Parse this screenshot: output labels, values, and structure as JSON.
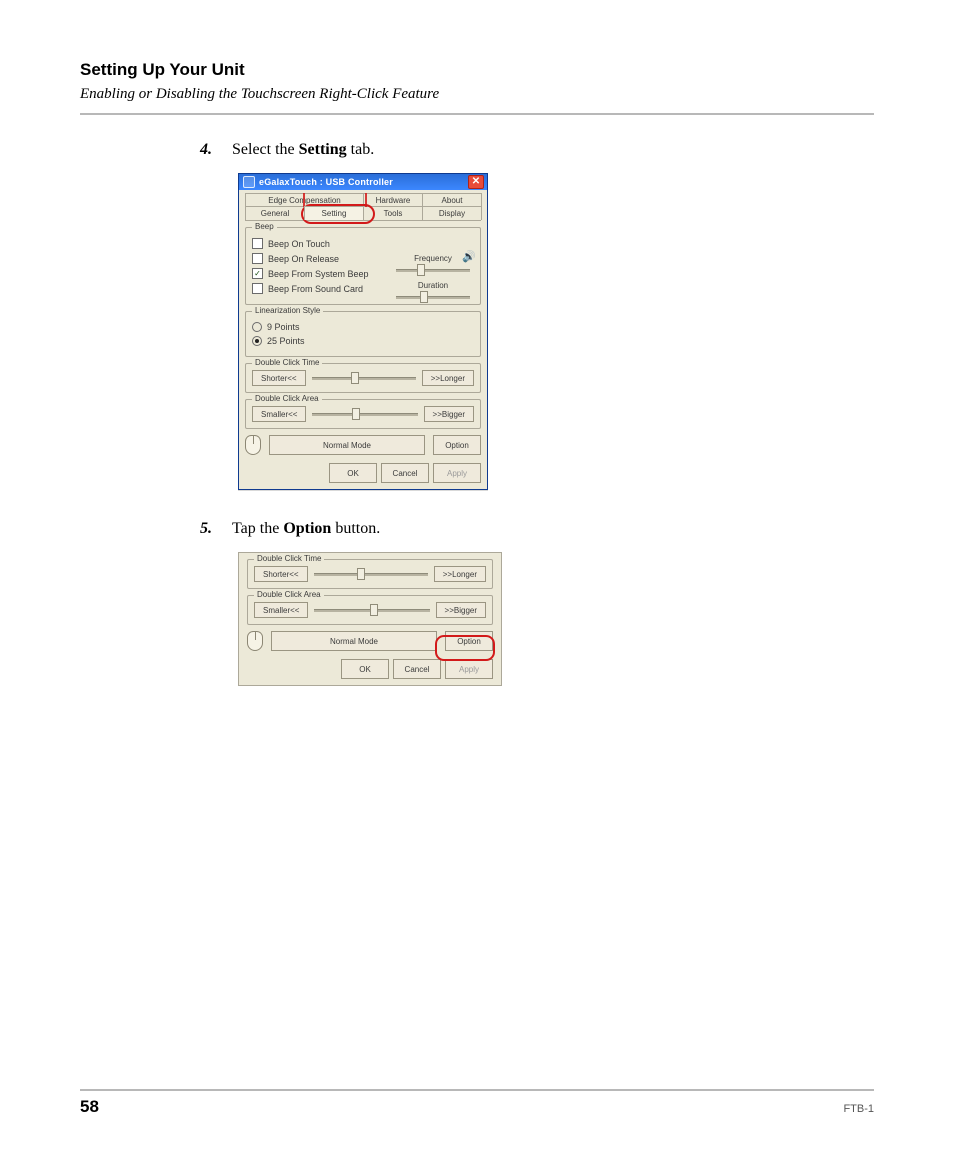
{
  "header": {
    "title": "Setting Up Your Unit",
    "subtitle": "Enabling or Disabling the Touchscreen Right-Click Feature"
  },
  "steps": {
    "s4": {
      "num": "4.",
      "pre": "Select the ",
      "bold": "Setting",
      "post": " tab."
    },
    "s5": {
      "num": "5.",
      "pre": "Tap the ",
      "bold": "Option",
      "post": " button."
    }
  },
  "shot1": {
    "window_title": "eGalaxTouch : USB Controller",
    "close_glyph": "✕",
    "tabs_row1": [
      "Edge Compensation",
      "Hardware",
      "About"
    ],
    "tabs_row2": [
      "General",
      "Setting",
      "Tools",
      "Display"
    ],
    "beep": {
      "legend": "Beep",
      "items": [
        {
          "label": "Beep On Touch",
          "checked": false
        },
        {
          "label": "Beep On Release",
          "checked": false
        },
        {
          "label": "Beep From System Beep",
          "checked": true
        },
        {
          "label": "Beep From Sound Card",
          "checked": false
        }
      ],
      "freq_label": "Frequency",
      "dur_label": "Duration"
    },
    "lin": {
      "legend": "Linearization Style",
      "opts": [
        {
          "label": "9 Points",
          "selected": false
        },
        {
          "label": "25 Points",
          "selected": true
        }
      ]
    },
    "dct": {
      "legend": "Double Click Time",
      "left_btn": "Shorter<<",
      "right_btn": ">>Longer"
    },
    "dca": {
      "legend": "Double Click Area",
      "left_btn": "Smaller<<",
      "right_btn": ">>Bigger"
    },
    "mode_label": "Normal Mode",
    "option_btn": "Option",
    "ok_btn": "OK",
    "cancel_btn": "Cancel",
    "apply_btn": "Apply"
  },
  "shot2": {
    "dct": {
      "legend": "Double Click Time",
      "left_btn": "Shorter<<",
      "right_btn": ">>Longer"
    },
    "dca": {
      "legend": "Double Click Area",
      "left_btn": "Smaller<<",
      "right_btn": ">>Bigger"
    },
    "mode_label": "Normal Mode",
    "option_btn": "Option",
    "ok_btn": "OK",
    "cancel_btn": "Cancel",
    "apply_btn": "Apply"
  },
  "footer": {
    "page_number": "58",
    "doc_code": "FTB-1"
  }
}
